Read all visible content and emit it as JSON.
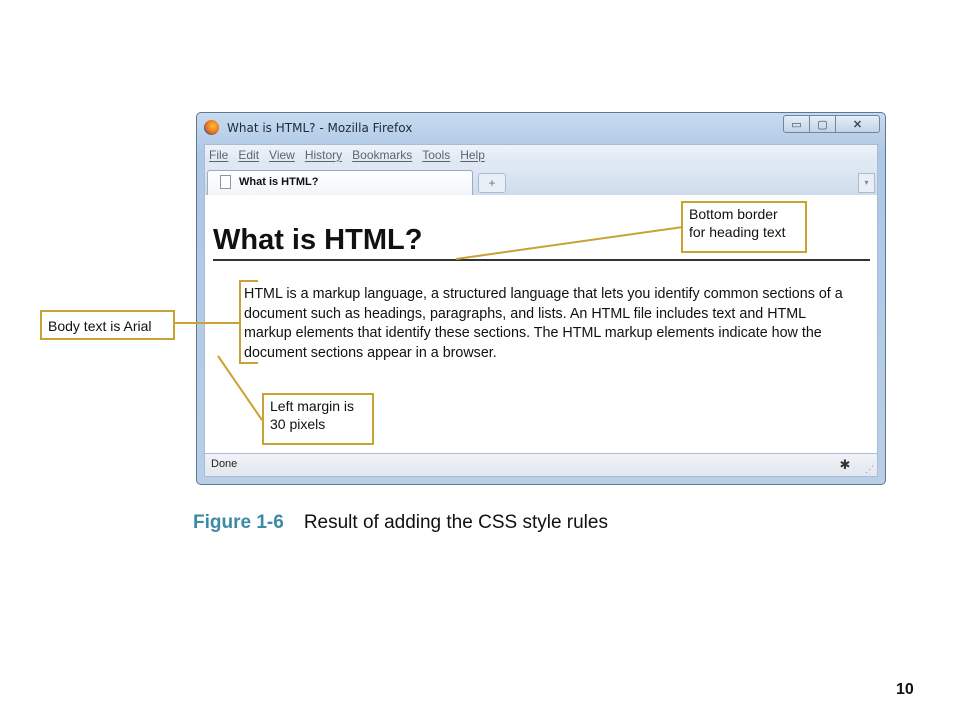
{
  "browser": {
    "title": "What is HTML? - Mozilla Firefox",
    "caption_buttons": {
      "minimize": "▭",
      "maximize": "▢",
      "close": "✕"
    },
    "menu": [
      "File",
      "Edit",
      "View",
      "History",
      "Bookmarks",
      "Tools",
      "Help"
    ],
    "tab_label": "What is HTML?",
    "new_tab_symbol": "+",
    "tab_list_symbol": "▾",
    "status_text": "Done",
    "icons": [
      "firefox-icon",
      "page-icon",
      "bug-icon",
      "resize-grip-icon"
    ]
  },
  "page": {
    "heading": "What is HTML?",
    "body_text": "HTML is a markup language, a structured language that lets you identify common sections of a document such as headings, paragraphs, and lists. An HTML file includes text and HTML markup elements that identify these sections. The HTML markup elements indicate how the document sections appear in a browser."
  },
  "callouts": {
    "bottom_border": "Bottom border\nfor heading text",
    "body_font": "Body text is Arial",
    "left_margin": "Left margin is\n30 pixels"
  },
  "figure": {
    "number": "Figure 1-6",
    "caption": "Result of adding the CSS style rules"
  },
  "slide_number": "10",
  "colors": {
    "callout_border": "#c8a233",
    "figure_number": "#3d8aa6"
  }
}
